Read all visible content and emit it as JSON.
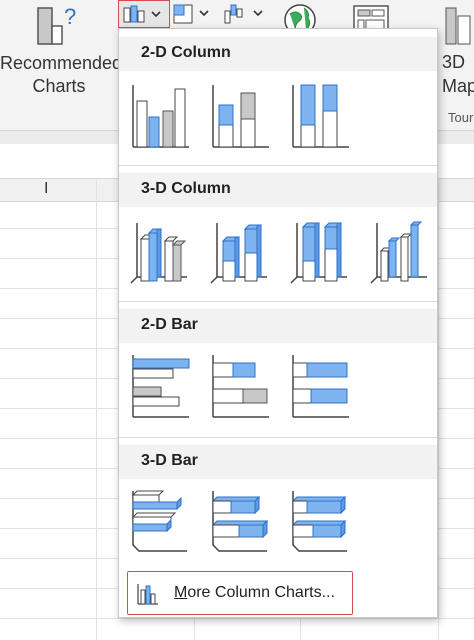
{
  "ribbon": {
    "recommended_line1": "Recommended",
    "recommended_line2": "Charts",
    "maps_line1": "3D",
    "maps_line2": "Map",
    "tours_label": "Tour"
  },
  "sheet": {
    "column_header": "I"
  },
  "dropdown": {
    "sections": [
      {
        "title": "2-D Column"
      },
      {
        "title": "3-D Column"
      },
      {
        "title": "2-D Bar"
      },
      {
        "title": "3-D Bar"
      }
    ],
    "more_first": "M",
    "more_rest": "ore Column Charts..."
  },
  "colors": {
    "accent_blue": "#7db4f0",
    "outline_blue": "#2f72c4",
    "gray_fill": "#c8c8c8",
    "highlight_red": "#d94b4b"
  }
}
